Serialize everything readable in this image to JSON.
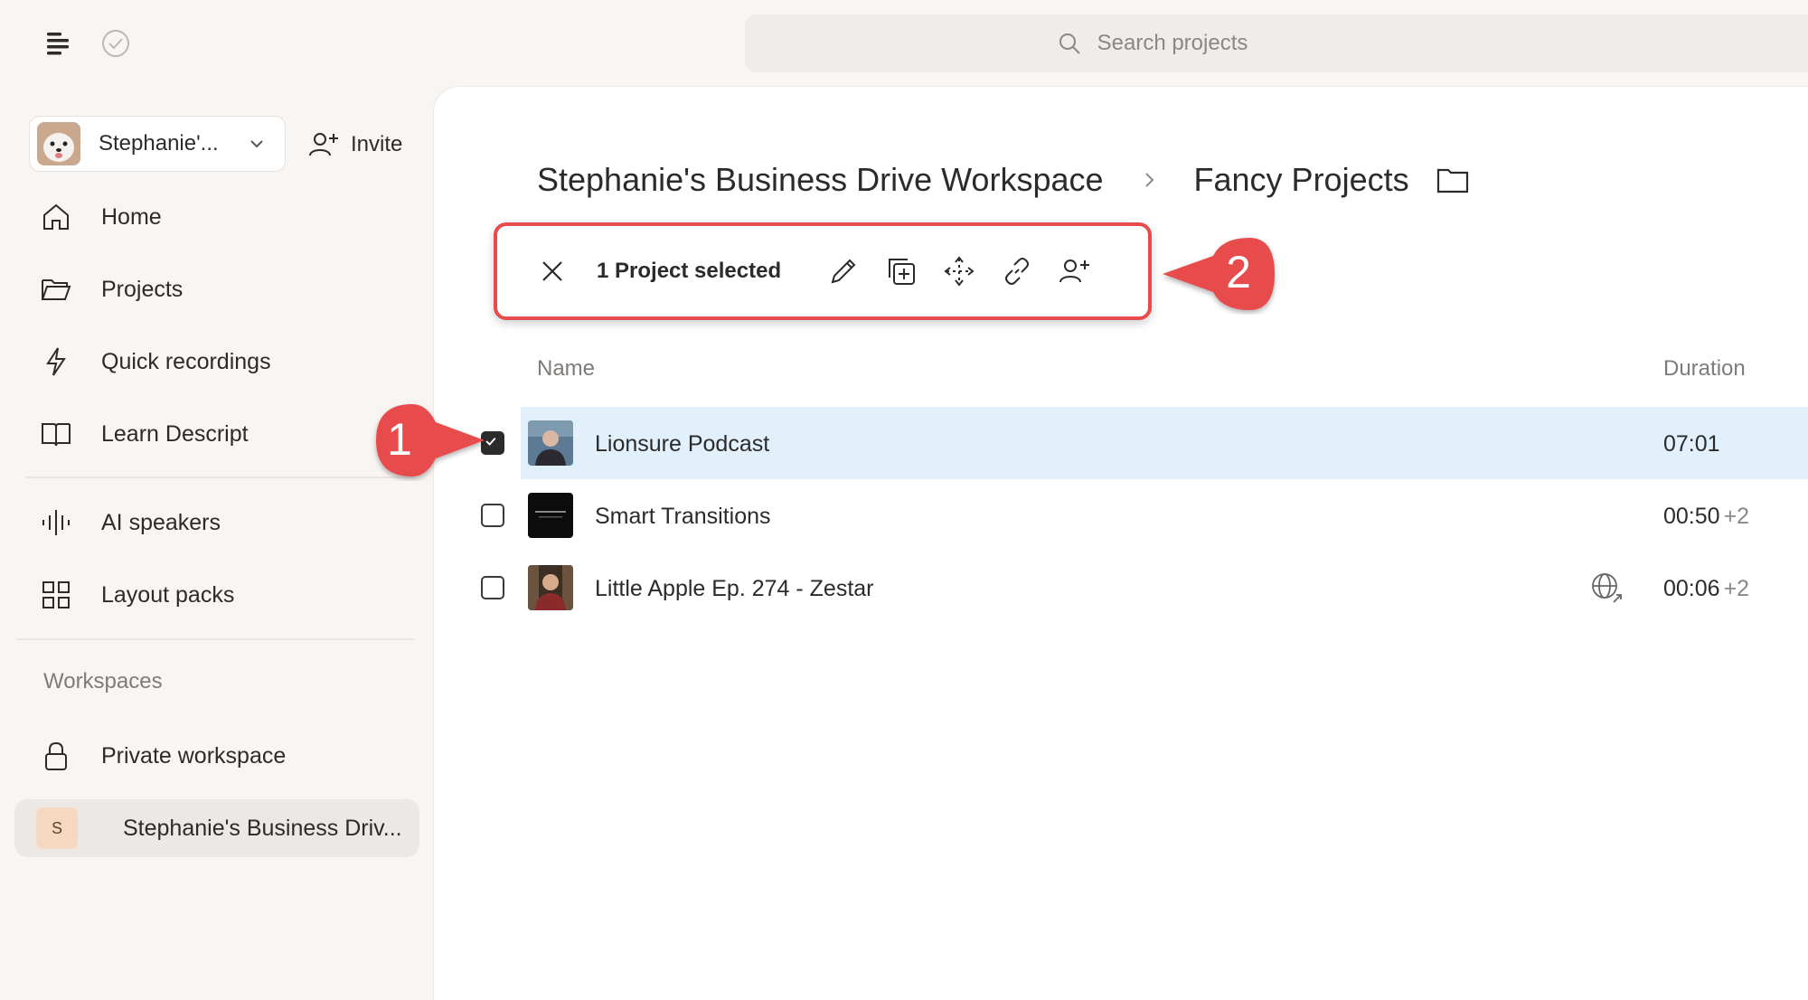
{
  "topbar": {
    "search_placeholder": "Search projects",
    "icons": [
      "descript-logo-icon",
      "check-circle-icon",
      "search-icon"
    ]
  },
  "sidebar": {
    "workspace_name": "Stephanie'...",
    "invite_label": "Invite",
    "nav": [
      {
        "label": "Home",
        "icon": "home-icon"
      },
      {
        "label": "Projects",
        "icon": "folder-open-icon"
      },
      {
        "label": "Quick recordings",
        "icon": "lightning-icon"
      },
      {
        "label": "Learn Descript",
        "icon": "book-icon"
      }
    ],
    "nav2": [
      {
        "label": "AI speakers",
        "icon": "waveform-icon"
      },
      {
        "label": "Layout packs",
        "icon": "grid-icon"
      }
    ],
    "workspaces_label": "Workspaces",
    "workspaces": [
      {
        "label": "Private workspace",
        "icon": "lock-icon"
      },
      {
        "label": "Stephanie's Business Driv...",
        "badge": "S"
      }
    ]
  },
  "main": {
    "breadcrumb": {
      "workspace": "Stephanie's Business Drive Workspace",
      "folder": "Fancy Projects"
    },
    "action_bar": {
      "selected_text": "1 Project selected",
      "tools": [
        "close-icon",
        "pencil-icon",
        "duplicate-icon",
        "move-icon",
        "link-icon",
        "add-person-icon"
      ]
    },
    "columns": {
      "name": "Name",
      "duration": "Duration"
    },
    "rows": [
      {
        "name": "Lionsure Podcast",
        "duration": "07:01",
        "extra": "",
        "selected": true
      },
      {
        "name": "Smart Transitions",
        "duration": "00:50",
        "extra": "+2",
        "selected": false
      },
      {
        "name": "Little Apple Ep. 274 - Zestar",
        "duration": "00:06",
        "extra": "+2",
        "selected": false,
        "shared": true
      }
    ]
  },
  "callouts": [
    "1",
    "2"
  ],
  "colors": {
    "callout": "#e84b4b",
    "selected_row": "#e2f0fb",
    "background": "#f9f5f3"
  }
}
